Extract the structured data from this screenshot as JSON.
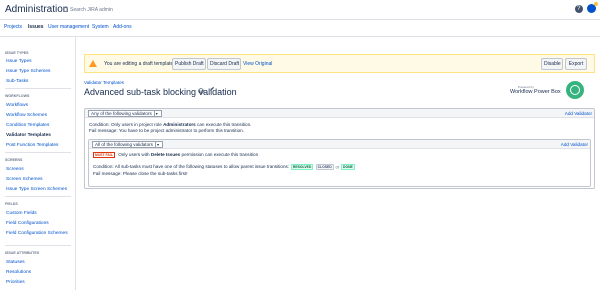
{
  "header": {
    "app_title": "Administration",
    "search_placeholder": "Search JIRA admin"
  },
  "nav_tabs": [
    {
      "label": "Projects"
    },
    {
      "label": "Issues"
    },
    {
      "label": "User management"
    },
    {
      "label": "System"
    },
    {
      "label": "Add-ons"
    }
  ],
  "sidebar": {
    "sections": [
      {
        "title": "ISSUE TYPES",
        "items": [
          "Issue Types",
          "Issue Type Schemes",
          "Sub-Tasks"
        ]
      },
      {
        "title": "WORKFLOWS",
        "items": [
          "Workflows",
          "Workflow Schemes",
          "Condition Templates",
          "Validator Templates",
          "Post Function Templates"
        ]
      },
      {
        "title": "SCREENS",
        "items": [
          "Screens",
          "Screen Schemes",
          "Issue Type Screen Schemes"
        ]
      },
      {
        "title": "FIELDS",
        "items": [
          "Custom Fields",
          "Field Configurations",
          "Field Configuration Schemes"
        ]
      },
      {
        "title": "ISSUE ATTRIBUTES",
        "items": [
          "Statuses",
          "Resolutions",
          "Priorities"
        ]
      }
    ],
    "active_item": "Validator Templates"
  },
  "draft_bar": {
    "message": "You are editing a draft template.",
    "publish_label": "Publish Draft",
    "discard_label": "Discard Draft",
    "view_original_label": "View Original",
    "disable_label": "Disable",
    "export_label": "Export"
  },
  "breadcrumb": "Validator Templates",
  "page_title": "Advanced sub-task blocking validation",
  "logo": {
    "small": "Powered by",
    "text": "Workflow Power Box"
  },
  "outer_group": {
    "select_label": "Any of the following validators",
    "add_label": "Add Validator",
    "condition_prefix": "Condition: Only users in project role",
    "condition_role": "Administrators",
    "condition_suffix": "can execute this transition.",
    "fail_message": "Fail message: You have to be project administrator to perform this transition."
  },
  "inner_group": {
    "select_label": "All of the following validators",
    "add_label": "Add Validator",
    "must_fail_label": "MUST FAIL",
    "rule_prefix": "Only users with",
    "rule_permission": "Delete Issues",
    "rule_suffix": "permission can execute this transition",
    "condition_text": "Condition: All sub-tasks must have one of the following statuses to allow parent issue transitions:",
    "status_resolved": "RESOLVED",
    "status_closed": "CLOSED",
    "or_text": "or",
    "status_done": "DONE",
    "fail_message": "Fail message: Please close the sub-tasks first!"
  },
  "colors": {
    "link": "#0052cc",
    "warning": "#ff991f",
    "logo": "#36b37e",
    "must_fail": "#de350b"
  }
}
